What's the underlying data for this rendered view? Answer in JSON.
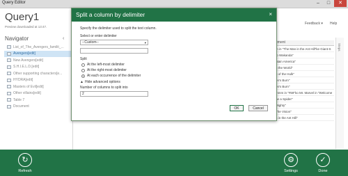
{
  "window": {
    "title": "Query Editor",
    "controls": [
      "–",
      "□",
      "✕"
    ]
  },
  "left": {
    "query_title": "Query1",
    "preview_time": "Preview downloaded at 13:47.",
    "navigator_title": "Navigator",
    "collapse_glyph": "‹",
    "items": [
      "List_of_The_Avengers_familit_...",
      "Avengers[edit]",
      "New Avengers[edit]",
      "S.H.I.E.L.D.[edit]",
      "Other supporting characters[e...",
      "HYDRA[edit]",
      "Masters of Evil[edit]",
      "Other villains[edit]",
      "Table 7",
      "Document"
    ],
    "selected_index": 1
  },
  "top_right": {
    "feedback": "Feedback",
    "feedback_caret": "▾",
    "help": "Help",
    "rail_label": "Steps"
  },
  "grid": {
    "header": "ement",
    "rows": [
      "m in \"The Man in the Ant Hill\"ke Giant-S",
      "to Wakanda\"",
      "ntain America\"",
      "g the World\"",
      "g of the Hulk\"",
      "en's Burn\"",
      "en's Burn\"",
      "mmm in \"#59\"ko Mr. Marvel in \"Welcome",
      "ne a Spider\"",
      "Mighty\"",
      "The Vision\"",
      "n in the Ant Hill\""
    ]
  },
  "modal": {
    "title": "Split a column by delimiter",
    "close_glyph": "×",
    "instruction": "Specify the delimiter used to split the text column.",
    "delimiter_label": "Select or enter delimiter",
    "delimiter_value": "--Custom--",
    "delimiter_caret": "▾",
    "custom_value": "",
    "split_label": "Split",
    "split_options": [
      "At the left-most delimiter",
      "At the right-most delimiter",
      "At each occurrence of the delimiter"
    ],
    "split_selected": 2,
    "advanced_toggle": "Hide advanced options",
    "advanced_glyph": "▲",
    "columns_label": "Number of columns to split into",
    "columns_value": "2",
    "ok_label": "OK",
    "cancel_label": "Cancel"
  },
  "bottom": {
    "refresh_label": "Refresh",
    "settings_label": "Settings",
    "done_label": "Done",
    "refresh_glyph": "↻",
    "settings_glyph": "⚙",
    "done_glyph": "✓"
  },
  "colors": {
    "accent": "#217346",
    "selected_bg": "#cfe4f5",
    "close_red": "#c9463d"
  }
}
